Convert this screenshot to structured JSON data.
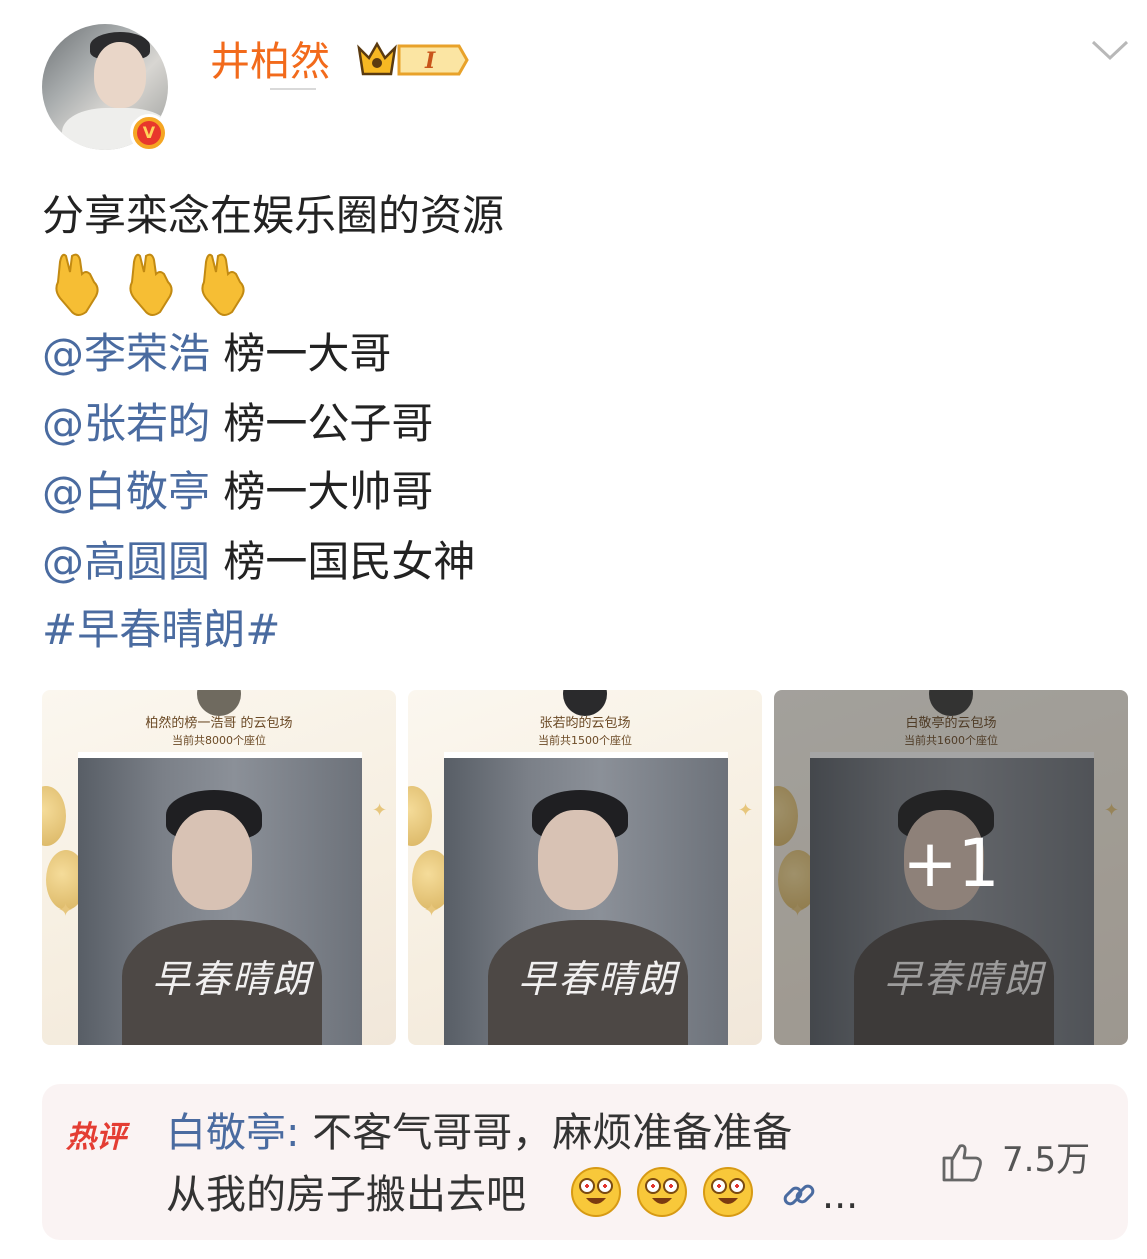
{
  "post": {
    "author": {
      "name": "井柏然",
      "level_badge": "I",
      "verified_mark": "V",
      "avatar": "avatar-photo"
    },
    "text_intro": "分享栾念在娱乐圈的资源",
    "emojis": [
      "pointing-down-icon",
      "pointing-down-icon",
      "pointing-down-icon"
    ],
    "mentions": [
      {
        "name": "@李荣浩",
        "desc": "榜一大哥"
      },
      {
        "name": "@张若昀",
        "desc": "榜一公子哥"
      },
      {
        "name": "@白敬亭",
        "desc": "榜一大帅哥"
      },
      {
        "name": "@高圆圆",
        "desc": "榜一国民女神"
      }
    ],
    "hashtag": "#早春晴朗#",
    "images": [
      {
        "title": "柏然的榜一浩哥 的云包场",
        "seats": "当前共8000个座位",
        "logo": "早春晴朗"
      },
      {
        "title": "张若昀的云包场",
        "seats": "当前共1500个座位",
        "logo": "早春晴朗"
      },
      {
        "title": "白敬亭的云包场",
        "seats": "当前共1600个座位",
        "logo": "早春晴朗"
      }
    ],
    "more_images": "+1"
  },
  "hot_comment": {
    "tag": "热评",
    "author": "白敬亭:",
    "text_line1": "不客气哥哥，麻烦准备准备",
    "text_line2": "从我的房子搬出去吧",
    "emojis": [
      "grinning-face-icon",
      "grinning-face-icon",
      "grinning-face-icon"
    ],
    "ellipsis": "...",
    "likes": "7.5万"
  },
  "colors": {
    "username": "#f26a1b",
    "link": "#4a6ba0",
    "hot_tag": "#e43d33",
    "comment_bg": "#faf3f3"
  }
}
